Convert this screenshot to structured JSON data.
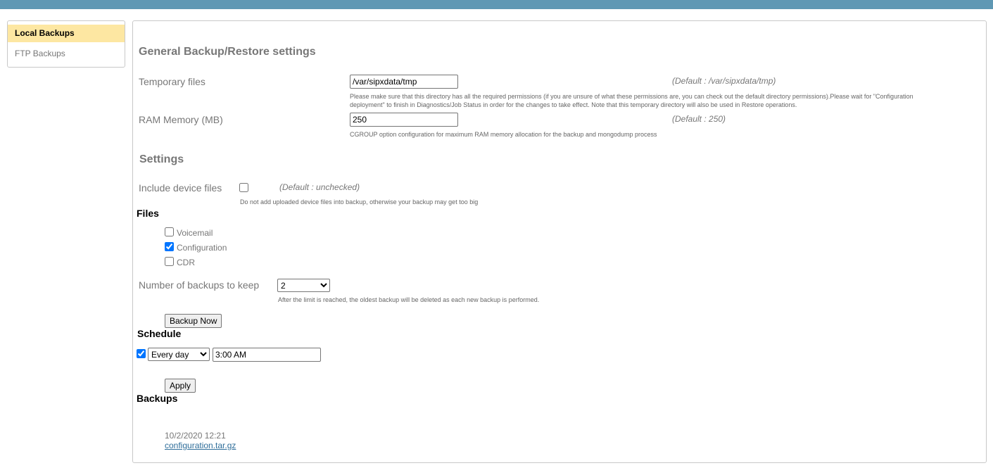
{
  "sidebar": {
    "items": [
      {
        "label": "Local Backups",
        "active": true
      },
      {
        "label": "FTP Backups",
        "active": false
      }
    ]
  },
  "general": {
    "title": "General Backup/Restore settings",
    "temp_files": {
      "label": "Temporary files",
      "value": "/var/sipxdata/tmp",
      "default": "(Default : /var/sipxdata/tmp)",
      "help1": "Please make sure that this directory has all the required permissions (if you are unsure of what these permissions are, you can check out the default directory permissions).Please wait for \"Configuration",
      "help2": "deployment\" to finish in Diagnostics/Job Status in order for the changes to take effect. Note that this temporary directory will also be used in Restore operations."
    },
    "ram": {
      "label": "RAM Memory (MB)",
      "value": "250",
      "default": "(Default : 250)",
      "help": "CGROUP option configuration for maximum RAM memory allocation for the backup and mongodump process"
    }
  },
  "settings": {
    "title": "Settings",
    "include_device": {
      "label": "Include device files",
      "checked": false,
      "default": "(Default : unchecked)",
      "help": "Do not add uploaded device files into backup, otherwise your backup may get too big"
    },
    "files_title": "Files",
    "files": [
      {
        "label": "Voicemail",
        "checked": false
      },
      {
        "label": "Configuration",
        "checked": true
      },
      {
        "label": "CDR",
        "checked": false
      }
    ],
    "keep": {
      "label": "Number of backups to keep",
      "value": "2",
      "help": "After the limit is reached, the oldest backup will be deleted as each new backup is performed."
    },
    "backup_now": "Backup Now"
  },
  "schedule": {
    "title": "Schedule",
    "enabled": true,
    "frequency": "Every day",
    "time": "3:00 AM",
    "apply": "Apply"
  },
  "backups": {
    "title": "Backups",
    "items": [
      {
        "date": "10/2/2020 12:21",
        "file": "configuration.tar.gz"
      }
    ]
  },
  "colors": {
    "topbar": "#5f98b4",
    "active_item": "#fde7a2",
    "link": "#2f6e9a"
  }
}
